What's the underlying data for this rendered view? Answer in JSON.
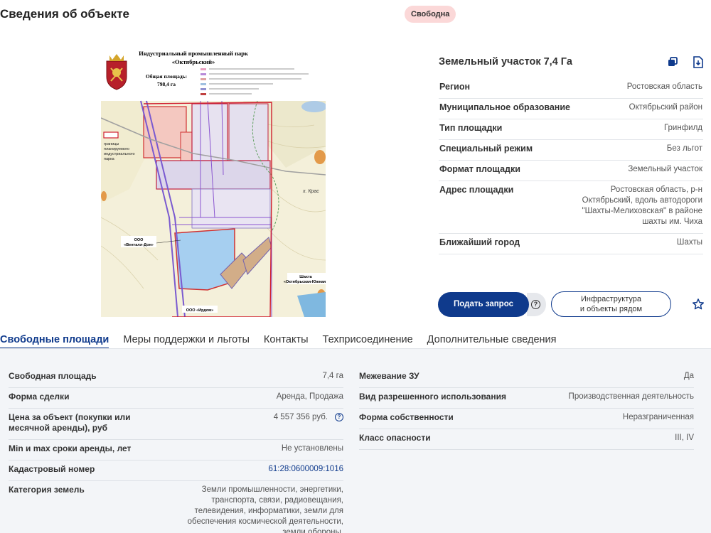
{
  "header": {
    "title": "Сведения об объекте",
    "status_badge": "Свободна"
  },
  "map": {
    "heading_line1": "Индустриальный промышленный парк",
    "heading_line2": "«Октябрьский»",
    "area_label": "Общая площадь:",
    "area_value": "798,4 га",
    "legend_boundary": "границы планируемого индустриального парка",
    "label_ventall": "ООО «Венталл-Дон»",
    "label_shakhta": "Шахта «Октябрьская-Южная»",
    "label_irdom": "ООО «Ирдом»",
    "label_khutor": "х. Крас"
  },
  "card": {
    "title": "Земельный участок 7,4 Га",
    "props": [
      {
        "key": "Регион",
        "value": "Ростовская область"
      },
      {
        "key": "Муниципальное образование",
        "value": "Октябрьский район"
      },
      {
        "key": "Тип площадки",
        "value": "Гринфилд"
      },
      {
        "key": "Специальный режим",
        "value": "Без льгот"
      },
      {
        "key": "Формат площадки",
        "value": "Земельный участок"
      },
      {
        "key": "Адрес площадки",
        "value": "Ростовская область, р-н Октябрьский, вдоль автодороги \"Шахты-Мелиховская\" в районе шахты им. Чиха"
      },
      {
        "key": "Ближайший город",
        "value": "Шахты"
      }
    ],
    "request_button": "Подать запрос",
    "infra_button_line1": "Инфраструктура",
    "infra_button_line2": "и объекты рядом"
  },
  "tabs": [
    "Свободные площади",
    "Меры поддержки и льготы",
    "Контакты",
    "Техприсоединение",
    "Дополнительные сведения"
  ],
  "details_left": [
    {
      "key": "Свободная площадь",
      "value": "7,4 га"
    },
    {
      "key": "Форма сделки",
      "value": "Аренда, Продажа"
    },
    {
      "key": "Цена за объект (покупки или месячной аренды), руб",
      "value": "4 557 356 руб."
    },
    {
      "key": "Min и max сроки аренды, лет",
      "value": "Не установлены"
    },
    {
      "key": "Кадастровый номер",
      "value": "61:28:0600009:1016"
    },
    {
      "key": "Категория земель",
      "value": "Земли промышленности, энергетики, транспорта, связи, радиовещания, телевидения, информатики, земли для обеспечения космической деятельности, земли обороны,"
    }
  ],
  "details_right": [
    {
      "key": "Межевание ЗУ",
      "value": "Да"
    },
    {
      "key": "Вид разрешенного использования",
      "value": "Производственная деятельность"
    },
    {
      "key": "Форма собственности",
      "value": "Неразграниченная"
    },
    {
      "key": "Класс опасности",
      "value": "III, IV"
    }
  ],
  "colors": {
    "accent": "#0f3a8c",
    "badge_bg": "#fbd8d8",
    "panel_bg": "#f3f5f8"
  }
}
